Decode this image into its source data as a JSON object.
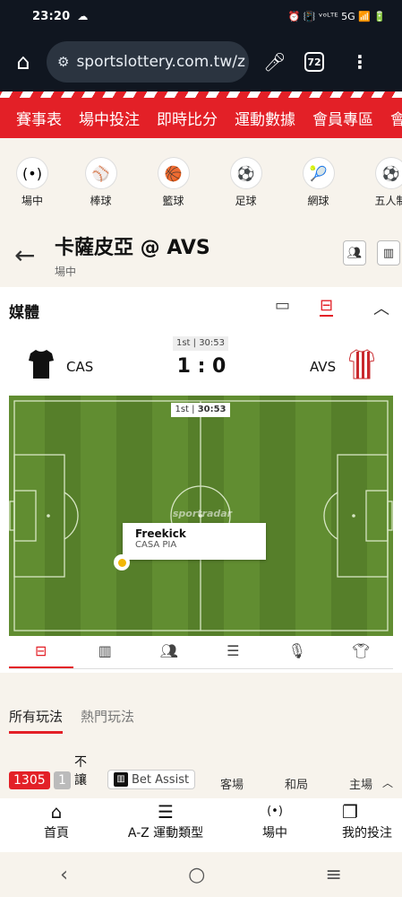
{
  "status_bar": {
    "time": "23:20",
    "cloud": "☁",
    "indicators": "⏰ 📳 ᵛᵒᴸᵀᴱ 5G 📶 🔋"
  },
  "browser": {
    "url": "sportslottery.com.tw/z",
    "tabs_count": "72"
  },
  "top_nav": [
    "賽事表",
    "場中投注",
    "即時比分",
    "運動數據",
    "會員專區",
    "會"
  ],
  "sports": [
    {
      "icon": "live-icon",
      "glyph": "(•)",
      "label": "場中"
    },
    {
      "icon": "baseball-icon",
      "glyph": "⚾",
      "label": "棒球"
    },
    {
      "icon": "basketball-icon",
      "glyph": "🏀",
      "label": "籃球"
    },
    {
      "icon": "soccer-icon",
      "glyph": "⚽",
      "label": "足球"
    },
    {
      "icon": "tennis-icon",
      "glyph": "🎾",
      "label": "網球"
    },
    {
      "icon": "futsal-icon",
      "glyph": "⚽",
      "label": "五人制"
    }
  ],
  "match": {
    "title": "卡薩皮亞 @ AVS",
    "subtitle": "場中"
  },
  "media": {
    "title": "媒體",
    "period": "1st | 30:53",
    "score": "1 : 0",
    "home_team": "CAS",
    "away_team": "AVS",
    "pitch_period": "1st",
    "pitch_time": "30:53",
    "event_title": "Freekick",
    "event_team": "CASA PIA",
    "watermark": "sportradar"
  },
  "bet_tabs": [
    "所有玩法",
    "熱門玩法"
  ],
  "game": {
    "id": "1305",
    "count": "1",
    "type": "不讓",
    "bet_assist": "Bet Assist",
    "cols": [
      "客場",
      "和局",
      "主場"
    ]
  },
  "bottom_nav": [
    {
      "icon": "home-icon",
      "glyph": "⌂",
      "label": "首頁"
    },
    {
      "icon": "hamburger-icon",
      "glyph": "☰",
      "label": "A-Z 運動類型"
    },
    {
      "icon": "live-icon",
      "glyph": "(•)",
      "label": "場中"
    },
    {
      "icon": "betslip-icon",
      "glyph": "❐",
      "label": "我的投注"
    }
  ],
  "colors": {
    "brand_red": "#e32027",
    "pitch_green": "#5e8c2e"
  }
}
